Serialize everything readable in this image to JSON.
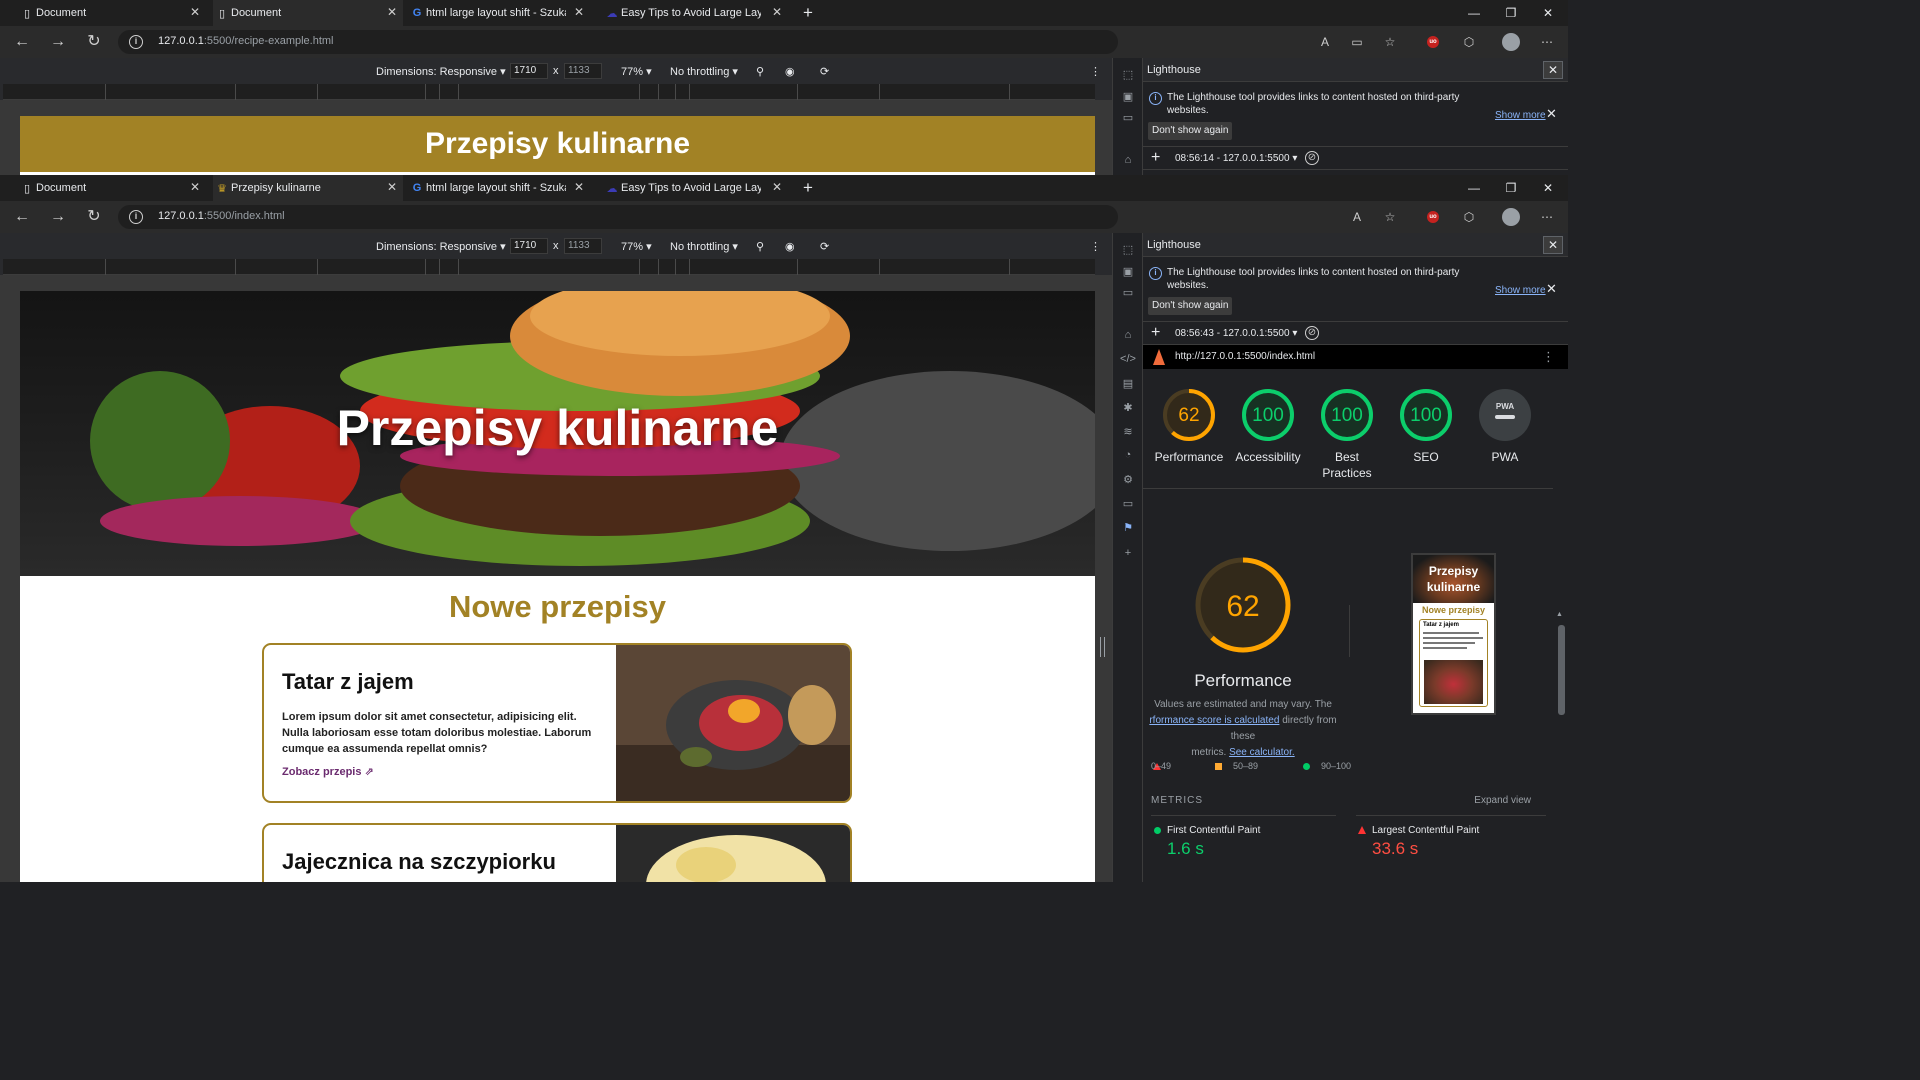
{
  "window1": {
    "tabs": [
      {
        "title": "Document",
        "icon": "document-icon",
        "active": false
      },
      {
        "title": "Document",
        "icon": "document-icon",
        "active": true
      },
      {
        "title": "html large layout shift - Szukaj w",
        "icon": "google-icon",
        "active": false
      },
      {
        "title": "Easy Tips to Avoid Large Layout S",
        "icon": "cloud-icon",
        "active": false
      }
    ],
    "url_host": "127.0.0.1",
    "url_path": ":5500/recipe-example.html",
    "page_header": "Przepisy kulinarne",
    "devtools": {
      "run": "08:56:14 - 127.0.0.1:5500"
    }
  },
  "window2": {
    "tabs": [
      {
        "title": "Document",
        "icon": "document-icon",
        "active": false
      },
      {
        "title": "Przepisy kulinarne",
        "icon": "chef-hat-icon",
        "active": true
      },
      {
        "title": "html large layout shift - Szukaj w",
        "icon": "google-icon",
        "active": false
      },
      {
        "title": "Easy Tips to Avoid Large Layout S",
        "icon": "cloud-icon",
        "active": false
      }
    ],
    "url_host": "127.0.0.1",
    "url_path": ":5500/index.html",
    "page": {
      "hero_title": "Przepisy kulinarne",
      "section_title": "Nowe przepisy",
      "cards": [
        {
          "title": "Tatar z jajem",
          "description": "Lorem ipsum dolor sit amet consectetur, adipisicing elit. Nulla laboriosam esse totam doloribus molestiae. Laborum cumque ea assumenda repellat omnis?",
          "link": "Zobacz przepis"
        },
        {
          "title": "Jajecznica na szczypiorku"
        }
      ]
    },
    "devtools": {
      "run": "08:56:43 - 127.0.0.1:5500",
      "report_url": "http://127.0.0.1:5500/index.html",
      "scores": [
        {
          "label": "Performance",
          "value": "62",
          "score": 0.62,
          "color": "#ffa400"
        },
        {
          "label": "Accessibility",
          "value": "100",
          "score": 1.0,
          "color": "#0cce6b"
        },
        {
          "label": "Best\nPractices",
          "value": "100",
          "score": 1.0,
          "color": "#0cce6b"
        },
        {
          "label": "SEO",
          "value": "100",
          "score": 1.0,
          "color": "#0cce6b"
        },
        {
          "label": "PWA",
          "value": "PWA",
          "score": null,
          "color": "#9aa0a6"
        }
      ],
      "big_perf": {
        "value": "62",
        "title": "Performance"
      },
      "note_line1": "Values are estimated and may vary. The",
      "note_link1": "rformance score is calculated",
      "note_line2": "directly from these",
      "note_line3": "metrics.",
      "note_link2": "See calculator.",
      "thumbnail": {
        "title": "Przepisy kulinarne",
        "section": "Nowe przepisy",
        "card": "Tatar z jajem"
      },
      "legend": [
        "0–49",
        "50–89",
        "90–100"
      ],
      "metrics_heading": "METRICS",
      "expand_view": "Expand view",
      "metrics": [
        {
          "name": "First Contentful Paint",
          "value": "1.6 s",
          "color": "#0cce6b"
        },
        {
          "name": "Largest Contentful Paint",
          "value": "33.6 s",
          "color": "#ff4e42"
        }
      ]
    }
  },
  "shared": {
    "dims_label": "Dimensions: Responsive",
    "width": "1710",
    "height": "1133",
    "times": "x",
    "zoom": "77%",
    "throttling": "No throttling",
    "lighthouse_title": "Lighthouse",
    "info_text": "The Lighthouse tool provides links to content hosted on third-party websites.",
    "show_more": "Show more",
    "dont_show": "Don't show again"
  },
  "colors": {
    "gold": "#a28225",
    "link_purple": "#6b2b6f"
  }
}
